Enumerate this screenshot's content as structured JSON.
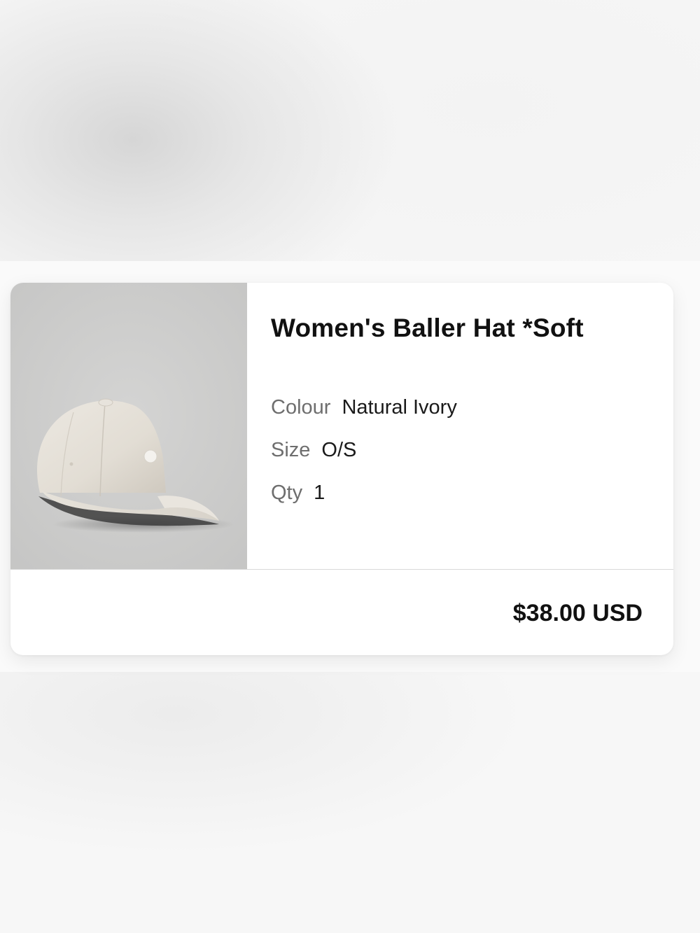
{
  "product": {
    "title": "Women's Baller Hat *Soft",
    "image_alt": "Women's Baller Hat *Soft in Natural Ivory",
    "attributes": [
      {
        "label": "Colour",
        "value": "Natural Ivory"
      },
      {
        "label": "Size",
        "value": "O/S"
      },
      {
        "label": "Qty",
        "value": "1"
      }
    ],
    "price": "$38.00 USD"
  },
  "colors": {
    "image_background": "#c9c9c8",
    "hat": "#e4e0d8",
    "text_primary": "#111111",
    "text_secondary": "#6e6e6e"
  }
}
